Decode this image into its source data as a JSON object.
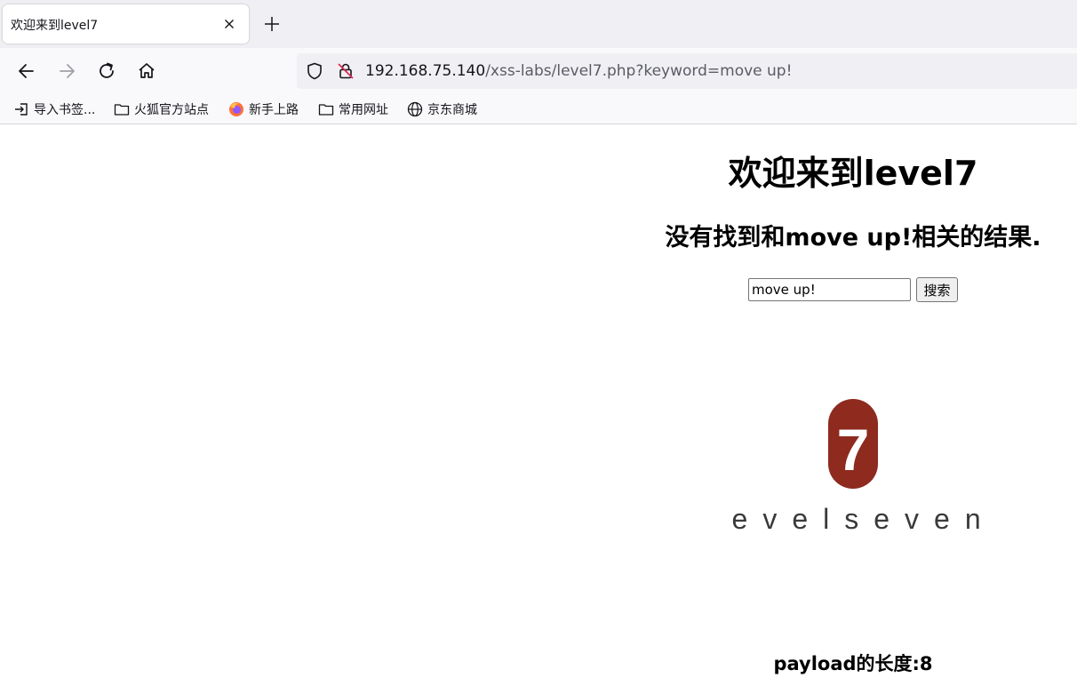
{
  "tab": {
    "title": "欢迎来到level7"
  },
  "url": {
    "host": "192.168.75.140",
    "path": "/xss-labs/level7.php?keyword=move up!"
  },
  "bookmarks": [
    {
      "label": "导入书签...",
      "icon": "import-icon"
    },
    {
      "label": "火狐官方站点",
      "icon": "folder-icon"
    },
    {
      "label": "新手上路",
      "icon": "firefox-icon"
    },
    {
      "label": "常用网址",
      "icon": "folder-icon"
    },
    {
      "label": "京东商城",
      "icon": "globe-icon"
    }
  ],
  "page": {
    "title": "欢迎来到level7",
    "message": "没有找到和move up!相关的结果.",
    "search": {
      "value": "move up!",
      "button_label": "搜索"
    },
    "logo": {
      "number": "7",
      "text": "levelseven",
      "badge_color": "#8e2a1e"
    },
    "payload": "payload的长度:8"
  }
}
